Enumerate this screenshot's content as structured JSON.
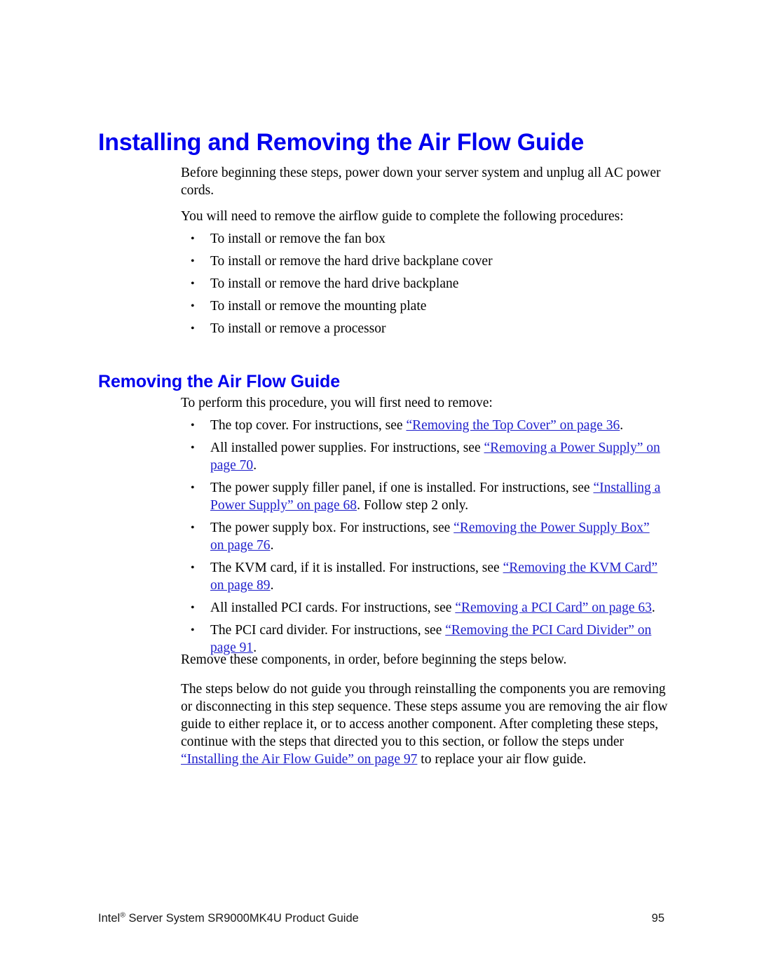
{
  "page": {
    "title": "Installing and Removing the Air Flow Guide",
    "accent_color": "#0000EE",
    "link_color": "#2020CC",
    "body_color": "#000000"
  },
  "intro": {
    "paragraph": "Before beginning these steps, power down your server system and unplug all AC power cords.",
    "lead_in": "You will need to remove the airflow guide to complete the following procedures:",
    "bullet_mark": "•",
    "items": [
      "To install or remove the fan box",
      "To install or remove the hard drive backplane cover",
      "To install or remove the hard drive backplane",
      "To install or remove the mounting plate",
      "To install or remove a processor"
    ]
  },
  "section": {
    "heading": "Removing the Air Flow Guide",
    "lead_in": "To perform this procedure, you will first need to remove:",
    "bullet_mark": "•",
    "items": [
      {
        "before": "The top cover. For instructions, see ",
        "link": "“Removing the Top Cover” on page 36",
        "after": "."
      },
      {
        "before": "All installed power supplies. For instructions, see ",
        "link": "“Removing a Power Supply” on page 70",
        "after": "."
      },
      {
        "before": "The power supply filler panel, if one is installed. For instructions, see ",
        "link": "“Installing a Power Supply” on page 68",
        "after": ". Follow step 2 only."
      },
      {
        "before": "The power supply box. For instructions, see ",
        "link": "“Removing the Power Supply Box” on page 76",
        "after": "."
      },
      {
        "before": "The KVM card, if it is installed. For instructions, see ",
        "link": "“Removing the KVM Card” on page 89",
        "after": "."
      },
      {
        "before": "All installed PCI cards. For instructions, see ",
        "link": "“Removing a PCI Card” on page 63",
        "after": "."
      },
      {
        "before": "The PCI card divider. For instructions, see ",
        "link": "“Removing the PCI Card Divider” on page 91",
        "after": "."
      }
    ],
    "note": "Remove these components, in order, before beginning the steps below.",
    "closing": {
      "before": "The steps below do not guide you through reinstalling the components you are removing or disconnecting in this step sequence. These steps assume you are removing the air flow guide to either replace it, or to access another component. After completing these steps, continue with the steps that directed you to this section, or follow the steps under ",
      "link": "“Installing the Air Flow Guide” on page 97",
      "after": " to replace your air flow guide."
    }
  },
  "footer": {
    "product_prefix": "Intel",
    "trademark": "®",
    "product_suffix": " Server System SR9000MK4U Product Guide",
    "page_number": "95"
  }
}
